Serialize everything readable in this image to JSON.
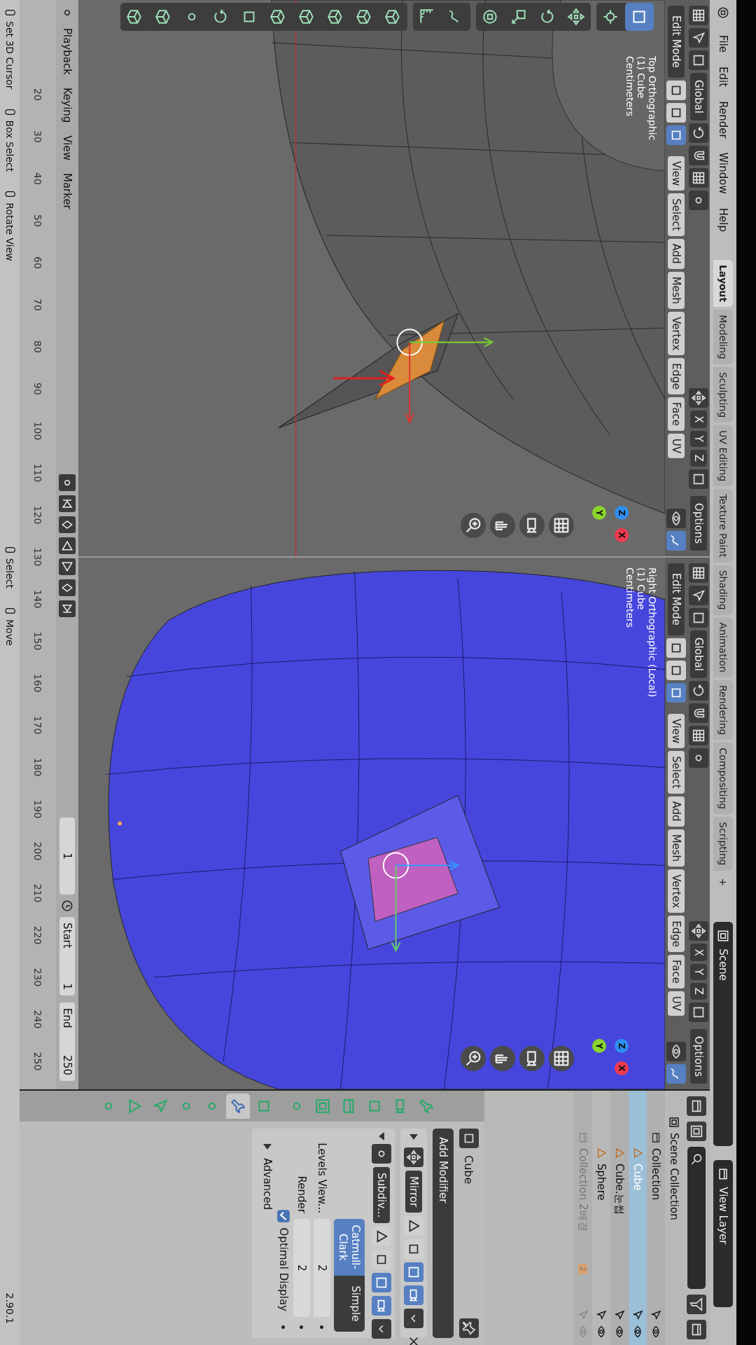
{
  "top_bar": {
    "menus": [
      "File",
      "Edit",
      "Render",
      "Window",
      "Help"
    ],
    "workspaces": [
      {
        "label": "Layout",
        "selected": true
      },
      {
        "label": "Modeling",
        "selected": false
      },
      {
        "label": "Sculpting",
        "selected": false
      },
      {
        "label": "UV Editing",
        "selected": false
      },
      {
        "label": "Texture Paint",
        "selected": false
      },
      {
        "label": "Shading",
        "selected": false
      },
      {
        "label": "Animation",
        "selected": false
      },
      {
        "label": "Rendering",
        "selected": false
      },
      {
        "label": "Compositing",
        "selected": false
      },
      {
        "label": "Scripting",
        "selected": false
      }
    ],
    "add_workspace": "+",
    "scene": "Scene",
    "view_layer": "View Layer"
  },
  "viewports": [
    {
      "kind": "wireframe",
      "orientation": "Global",
      "mirror_axes": [
        "X",
        "Y",
        "Z"
      ],
      "options": "Options",
      "mode": "Edit Mode",
      "select_modes": [
        {
          "selected": false
        },
        {
          "selected": false
        },
        {
          "selected": true
        }
      ],
      "menus": [
        "View",
        "Select",
        "Add",
        "Mesh",
        "Vertex",
        "Edge",
        "Face",
        "UV"
      ],
      "overlay": [
        "Top Orthographic",
        "(1) Cube",
        "Centimeters"
      ],
      "gizmo": [
        "X",
        "Y",
        "Z"
      ],
      "has_toolbar": true
    },
    {
      "kind": "solid",
      "orientation": "Global",
      "mirror_axes": [
        "X",
        "Y",
        "Z"
      ],
      "options": "Options",
      "mode": "Edit Mode",
      "select_modes": [
        {
          "selected": false
        },
        {
          "selected": false
        },
        {
          "selected": true
        }
      ],
      "menus": [
        "View",
        "Select",
        "Add",
        "Mesh",
        "Vertex",
        "Edge",
        "Face",
        "UV"
      ],
      "overlay": [
        "Right Orthographic (Local)",
        "(1) Cube",
        "Centimeters"
      ],
      "gizmo": [
        "X",
        "Y",
        "Z"
      ],
      "has_toolbar": false
    }
  ],
  "toolbar": [
    [
      {
        "selected": true
      },
      {
        "selected": false
      }
    ],
    [
      {
        "selected": false
      },
      {
        "selected": false
      },
      {
        "selected": false
      },
      {
        "selected": false
      }
    ],
    [
      {
        "selected": false
      },
      {
        "selected": false
      }
    ],
    [
      {
        "selected": false
      },
      {
        "selected": false
      },
      {
        "selected": false
      },
      {
        "selected": false
      },
      {
        "selected": false
      },
      {
        "selected": false
      },
      {
        "selected": false
      },
      {
        "selected": false
      },
      {
        "selected": false
      },
      {
        "selected": false
      }
    ]
  ],
  "timeline": {
    "menus": [
      "Playback",
      "Keying",
      "View",
      "Marker"
    ],
    "current_frame": "1",
    "start_label": "Start",
    "start": "1",
    "end_label": "End",
    "end": "250",
    "ruler": [
      "20",
      "30",
      "40",
      "50",
      "60",
      "70",
      "80",
      "90",
      "100",
      "110",
      "120",
      "130",
      "140",
      "150",
      "160",
      "170",
      "180",
      "190",
      "200",
      "210",
      "220",
      "230",
      "240",
      "250"
    ]
  },
  "status_bar": {
    "hint_groups": [
      [
        "Set 3D Cursor",
        "Box Select",
        "Rotate View"
      ],
      [
        "Select",
        "Move"
      ]
    ],
    "version": "2.90.1"
  },
  "outliner": {
    "tree": [
      {
        "label": "Scene Collection",
        "kind": "scene",
        "children": [
          {
            "label": "Collection",
            "kind": "collection",
            "disabled": false,
            "children": [
              {
                "label": "Cube",
                "kind": "mesh",
                "selected": true
              },
              {
                "label": "Cube.눈썹",
                "kind": "mesh",
                "selected": false
              },
              {
                "label": "Sphere",
                "kind": "mesh",
                "selected": false
              }
            ]
          },
          {
            "label": "Collection 2배경",
            "kind": "collection",
            "disabled": true,
            "badge": "2"
          }
        ]
      }
    ]
  },
  "properties": {
    "tabs": [
      {
        "selected": false
      },
      {
        "selected": false
      },
      {
        "selected": false
      },
      {
        "selected": false
      },
      {
        "selected": false
      },
      {
        "selected": false
      },
      {
        "selected": false
      },
      {
        "selected": true
      },
      {
        "selected": false
      },
      {
        "selected": false
      },
      {
        "selected": false
      },
      {
        "selected": false
      },
      {
        "selected": false
      }
    ],
    "object": "Cube",
    "add_modifier": "Add Modifier",
    "modifiers": [
      {
        "name": "Mirror",
        "kind": "mirror",
        "expanded": false
      },
      {
        "name": "Subdiv...",
        "kind": "subdivision",
        "expanded": true
      }
    ],
    "subdivision": {
      "types": [
        {
          "label": "Catmull-Clark",
          "selected": true
        },
        {
          "label": "Simple",
          "selected": false
        }
      ],
      "fields": [
        {
          "label": "Levels View...",
          "value": "2"
        },
        {
          "label": "Render",
          "value": "2"
        }
      ],
      "optimal_display": {
        "label": "Optimal Display",
        "checked": true
      },
      "advanced": {
        "label": "Advanced",
        "expanded": false
      }
    }
  }
}
